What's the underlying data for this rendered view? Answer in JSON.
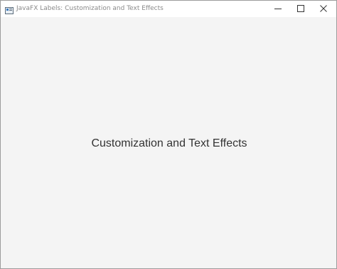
{
  "window": {
    "title": "JavaFX Labels: Customization and Text Effects",
    "controls": [
      "minimize-icon",
      "maximize-icon",
      "close-icon"
    ]
  },
  "content": {
    "label_text": "Customization and Text Effects",
    "background": "#f4f4f4",
    "text_color": "#333333"
  }
}
